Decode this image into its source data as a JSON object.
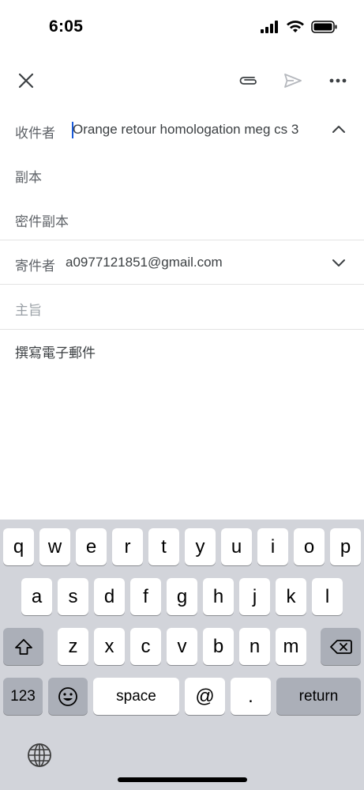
{
  "status_bar": {
    "time": "6:05"
  },
  "compose": {
    "to_label": "收件者",
    "to_value": "Orange retour homologation meg cs 3",
    "cc_label": "副本",
    "bcc_label": "密件副本",
    "from_label": "寄件者",
    "from_value": "a0977121851@gmail.com",
    "subject_placeholder": "主旨",
    "body_placeholder": "撰寫電子郵件"
  },
  "keyboard": {
    "row1": [
      "q",
      "w",
      "e",
      "r",
      "t",
      "y",
      "u",
      "i",
      "o",
      "p"
    ],
    "row2": [
      "a",
      "s",
      "d",
      "f",
      "g",
      "h",
      "j",
      "k",
      "l"
    ],
    "row3": [
      "z",
      "x",
      "c",
      "v",
      "b",
      "n",
      "m"
    ],
    "numbers_label": "123",
    "space_label": "space",
    "at_label": "@",
    "dot_label": ".",
    "return_label": "return"
  },
  "icons": {
    "close": "close-icon",
    "attach": "paperclip-icon",
    "send": "send-icon",
    "more": "more-horizontal-icon",
    "collapse": "chevron-up-icon",
    "expand": "chevron-down-icon",
    "shift": "shift-icon",
    "delete": "backspace-icon",
    "emoji": "emoji-icon",
    "globe": "globe-icon"
  },
  "colors": {
    "cursor": "#1a5ad8",
    "keyboard_bg": "#d2d4da",
    "dark_key": "#abafb8"
  }
}
